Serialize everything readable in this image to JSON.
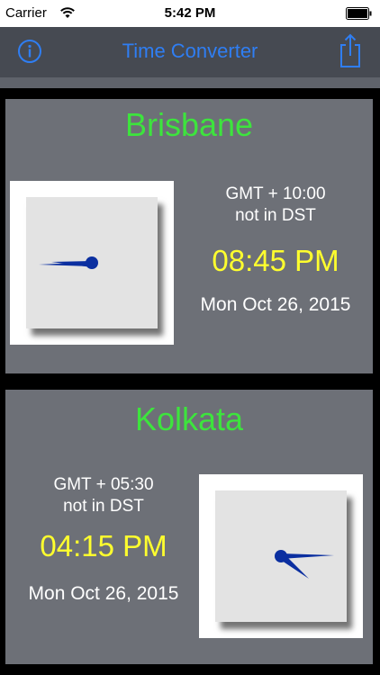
{
  "status_bar": {
    "carrier": "Carrier",
    "time": "5:42 PM",
    "wifi_icon": "wifi-icon",
    "battery_icon": "battery-icon"
  },
  "nav": {
    "title": "Time Converter",
    "info_icon": "info-icon",
    "share_icon": "share-icon"
  },
  "colors": {
    "accent": "#2f7ef3",
    "city_name": "#3de43d",
    "time": "#ffff2e",
    "card_background": "#6d7077",
    "clock_hands": "#0b2fa0"
  },
  "cities": [
    {
      "name": "Brisbane",
      "gmt_offset": "GMT + 10:00",
      "dst_status": "not in DST",
      "time": "08:45 PM",
      "date": "Mon Oct 26, 2015"
    },
    {
      "name": "Kolkata",
      "gmt_offset": "GMT + 05:30",
      "dst_status": "not in DST",
      "time": "04:15 PM",
      "date": "Mon Oct 26, 2015"
    }
  ]
}
